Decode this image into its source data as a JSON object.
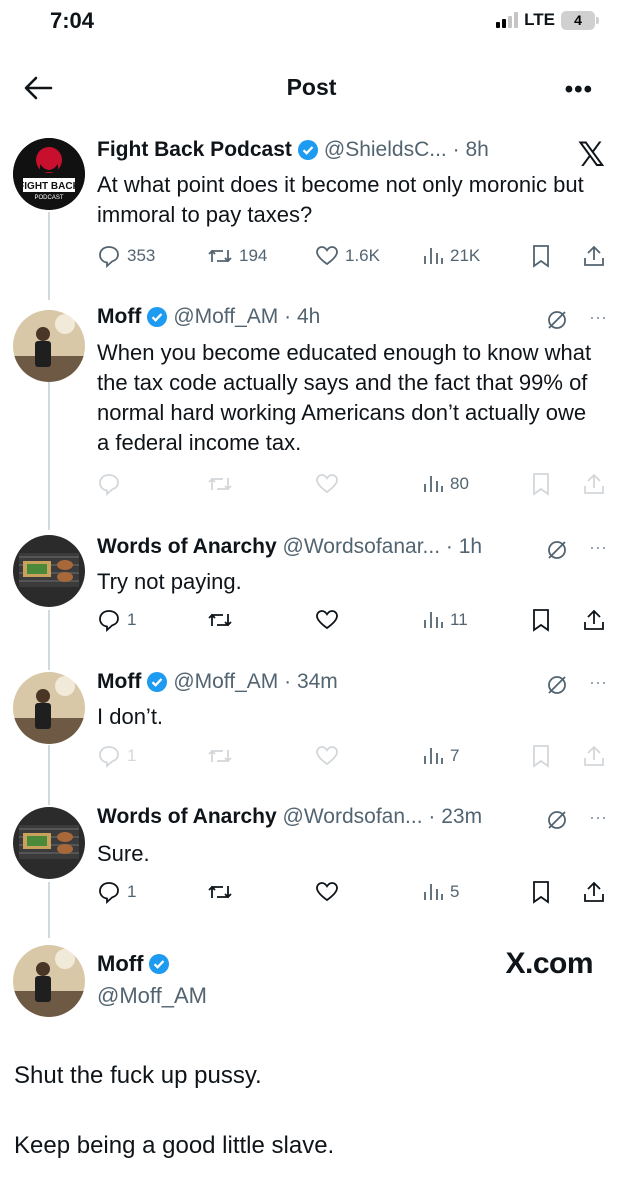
{
  "status": {
    "time": "7:04",
    "network": "LTE",
    "battery": "4"
  },
  "header": {
    "title": "Post"
  },
  "tweets": [
    {
      "name": "Fight Back Podcast",
      "handle": "@ShieldsC...",
      "time": "8h",
      "text": "At what point does it become not only moronic but immoral to pay taxes?",
      "replies": "353",
      "retweets": "194",
      "likes": "1.6K",
      "views": "21K"
    },
    {
      "name": "Moff",
      "handle": "@Moff_AM",
      "time": "4h",
      "text": "When you become educated enough to know what the tax code actually says and the fact that 99% of normal hard working Americans don’t actually owe a federal income tax.",
      "views": "80"
    },
    {
      "name": "Words of Anarchy",
      "handle": "@Wordsofanar...",
      "time": "1h",
      "text": "Try not paying.",
      "replies": "1",
      "views": "11"
    },
    {
      "name": "Moff",
      "handle": "@Moff_AM",
      "time": "34m",
      "text": "I don’t.",
      "replies": "1",
      "views": "7"
    },
    {
      "name": "Words of Anarchy",
      "handle": "@Wordsofan...",
      "time": "23m",
      "text": "Sure.",
      "replies": "1",
      "views": "5"
    }
  ],
  "final": {
    "name": "Moff",
    "handle": "@Moff_AM",
    "brand": "X.com",
    "line1": "Shut the fuck up pussy.",
    "line2": "Keep being a good little slave."
  },
  "colors": {
    "verified": "#1d9bf0",
    "muted": "#536471",
    "line": "#cfd9de"
  }
}
